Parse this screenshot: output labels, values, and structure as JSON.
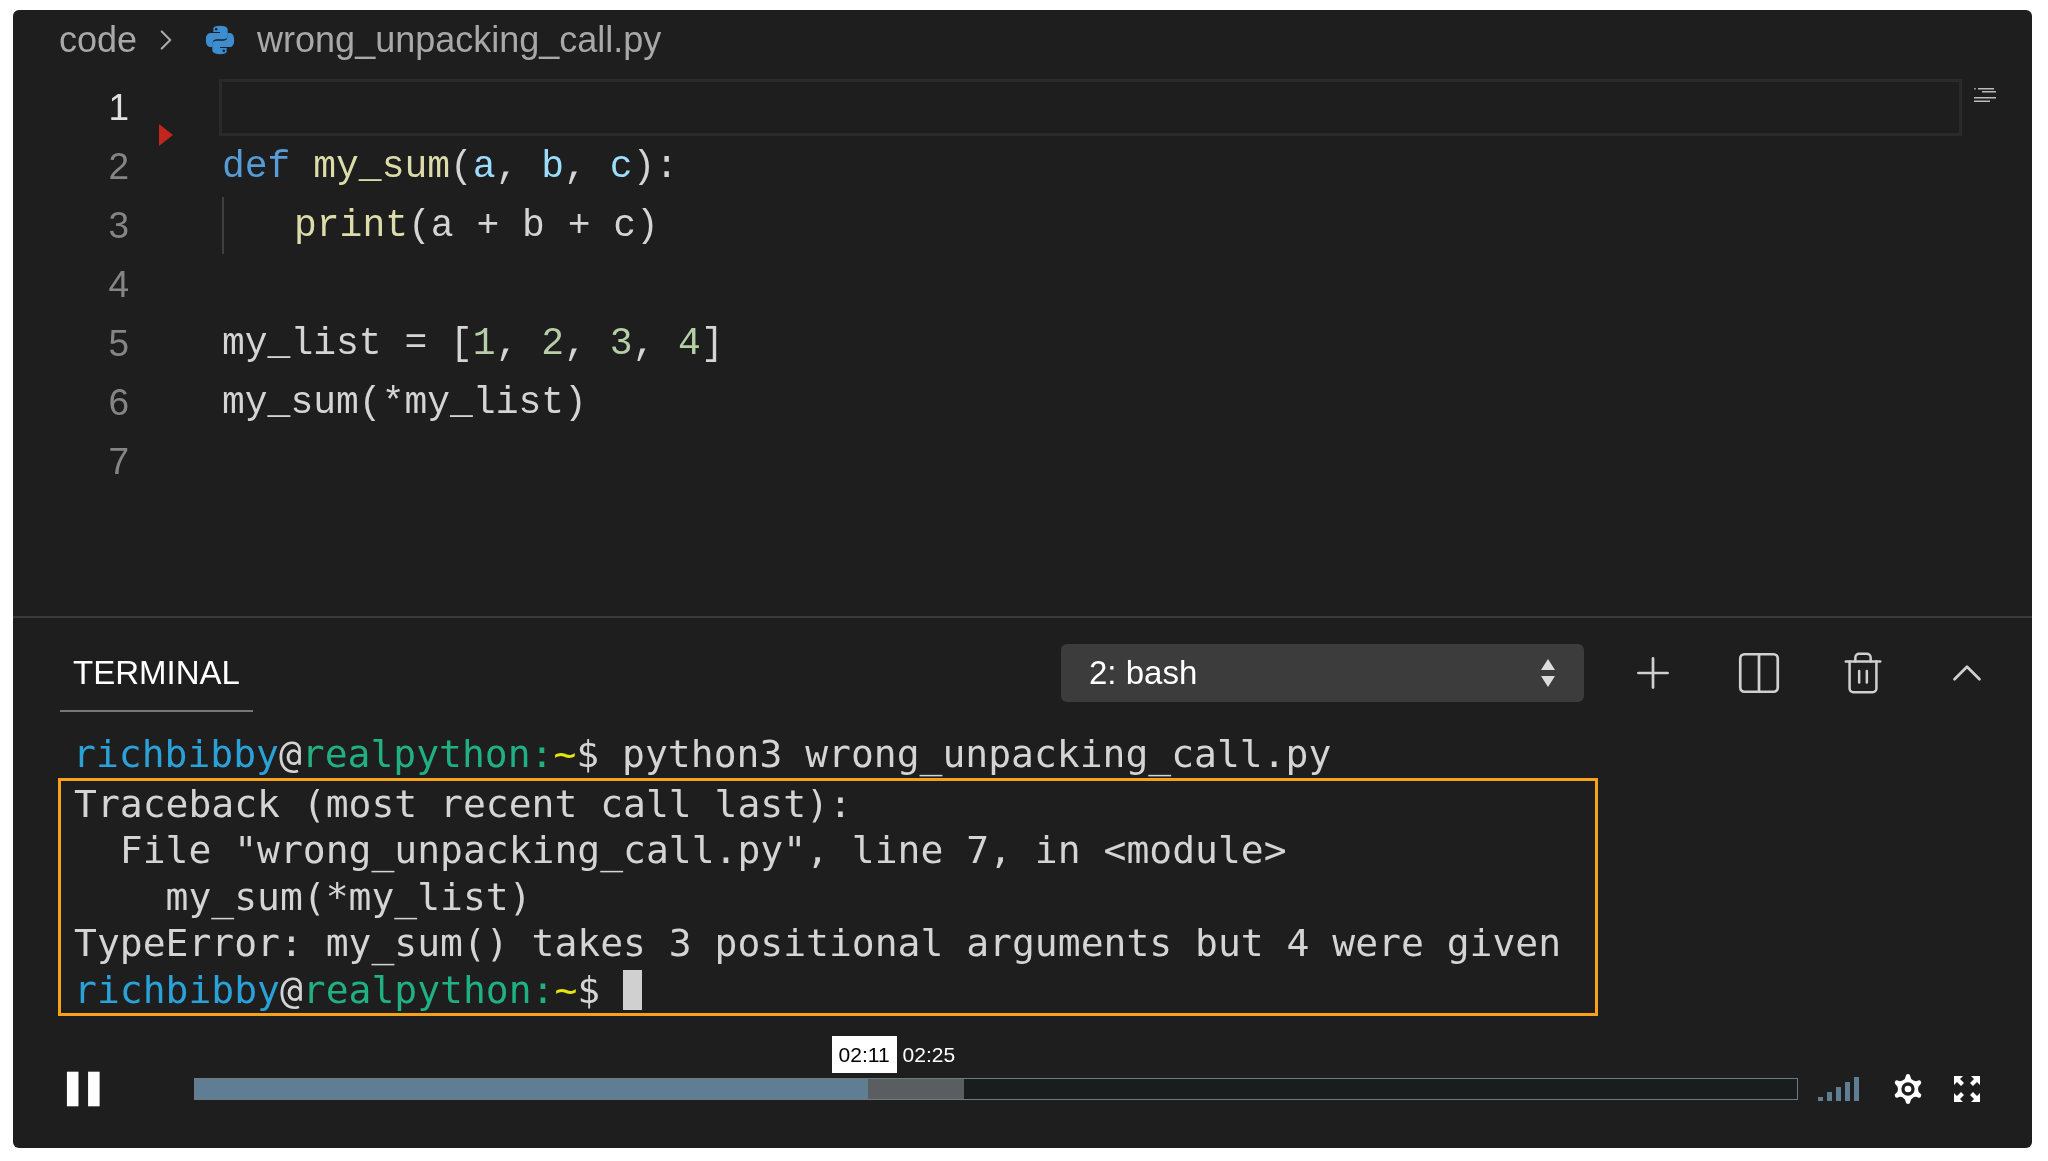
{
  "breadcrumb": {
    "folder": "code",
    "file": "wrong_unpacking_call.py"
  },
  "editor": {
    "lines": [
      {
        "number": "1",
        "current": true,
        "marker": false,
        "indented": false
      },
      {
        "number": "2",
        "current": false,
        "marker": true,
        "indented": false,
        "tokens": [
          {
            "kind": "keyword",
            "text": "def "
          },
          {
            "kind": "function",
            "text": "my_sum"
          },
          {
            "kind": "plain",
            "text": "("
          },
          {
            "kind": "param",
            "text": "a"
          },
          {
            "kind": "plain",
            "text": ", "
          },
          {
            "kind": "param",
            "text": "b"
          },
          {
            "kind": "plain",
            "text": ", "
          },
          {
            "kind": "param",
            "text": "c"
          },
          {
            "kind": "plain",
            "text": "):"
          }
        ]
      },
      {
        "number": "3",
        "current": false,
        "marker": false,
        "indented": true,
        "tokens": [
          {
            "kind": "function",
            "text": "print"
          },
          {
            "kind": "plain",
            "text": "(a + b + c)"
          }
        ]
      },
      {
        "number": "4",
        "current": false,
        "marker": false,
        "indented": false
      },
      {
        "number": "5",
        "current": false,
        "marker": false,
        "indented": false,
        "tokens": [
          {
            "kind": "plain",
            "text": "my_list = ["
          },
          {
            "kind": "number",
            "text": "1"
          },
          {
            "kind": "plain",
            "text": ", "
          },
          {
            "kind": "number",
            "text": "2"
          },
          {
            "kind": "plain",
            "text": ", "
          },
          {
            "kind": "number",
            "text": "3"
          },
          {
            "kind": "plain",
            "text": ", "
          },
          {
            "kind": "number",
            "text": "4"
          },
          {
            "kind": "plain",
            "text": "]"
          }
        ]
      },
      {
        "number": "6",
        "current": false,
        "marker": false,
        "indented": false,
        "tokens": [
          {
            "kind": "plain",
            "text": "my_sum(*my_list)"
          }
        ]
      },
      {
        "number": "7",
        "current": false,
        "marker": false,
        "indented": false
      }
    ]
  },
  "panel": {
    "tabs": [
      {
        "label": "TERMINAL",
        "selected": true
      }
    ],
    "terminal_select": "2: bash"
  },
  "terminal": {
    "lines": [
      {
        "highlighted": false,
        "cursor": false,
        "segments": [
          {
            "kind": "user",
            "text": "richbibby"
          },
          {
            "kind": "plain",
            "text": "@"
          },
          {
            "kind": "host",
            "text": "realpython:"
          },
          {
            "kind": "path",
            "text": "~"
          },
          {
            "kind": "plain",
            "text": "$ python3 wrong_unpacking_call.py"
          }
        ]
      },
      {
        "highlighted": true,
        "cursor": false,
        "segments": [
          {
            "kind": "plain",
            "text": "Traceback (most recent call last):"
          }
        ]
      },
      {
        "highlighted": true,
        "cursor": false,
        "segments": [
          {
            "kind": "plain",
            "text": "  File \"wrong_unpacking_call.py\", line 7, in <module>"
          }
        ]
      },
      {
        "highlighted": true,
        "cursor": false,
        "segments": [
          {
            "kind": "plain",
            "text": "    my_sum(*my_list)"
          }
        ]
      },
      {
        "highlighted": true,
        "cursor": false,
        "segments": [
          {
            "kind": "plain",
            "text": "TypeError: my_sum() takes 3 positional arguments but 4 were given"
          }
        ]
      },
      {
        "highlighted": true,
        "cursor": true,
        "segments": [
          {
            "kind": "user",
            "text": "richbibby"
          },
          {
            "kind": "plain",
            "text": "@"
          },
          {
            "kind": "host",
            "text": "realpython:"
          },
          {
            "kind": "path",
            "text": "~"
          },
          {
            "kind": "plain",
            "text": "$ "
          }
        ]
      }
    ]
  },
  "player": {
    "playing": true,
    "progress": {
      "level": 0.42
    },
    "buffered": {
      "level": 0.48
    },
    "hover_time": "02:11",
    "duration": "02:25"
  }
}
